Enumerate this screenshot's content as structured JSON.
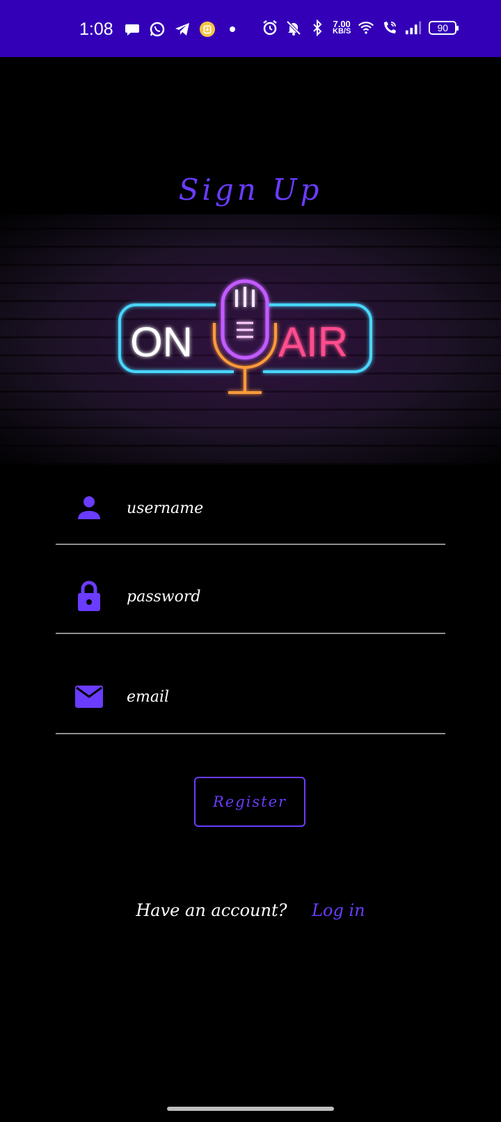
{
  "status_bar": {
    "time": "1:08",
    "net_speed_value": "7.00",
    "net_speed_unit": "KB/S",
    "battery": "90",
    "icons_left": [
      "chat-bubble-icon",
      "whatsapp-icon",
      "telegram-icon",
      "download-badge-icon",
      "dot-icon"
    ],
    "icons_right": [
      "alarm-icon",
      "bell-off-icon",
      "bluetooth-icon",
      "wifi-icon",
      "wifi-call-icon",
      "signal-icon"
    ]
  },
  "title": "Sign Up",
  "logo": {
    "left_text": "ON",
    "right_text": "AIR"
  },
  "form": {
    "username_placeholder": "username",
    "password_placeholder": "password",
    "email_placeholder": "email"
  },
  "register_label": "Register",
  "footer": {
    "question": "Have an account?",
    "login_label": "Log in"
  },
  "colors": {
    "status_bar": "#3300b8",
    "accent": "#6a3cff",
    "background": "#000000"
  }
}
